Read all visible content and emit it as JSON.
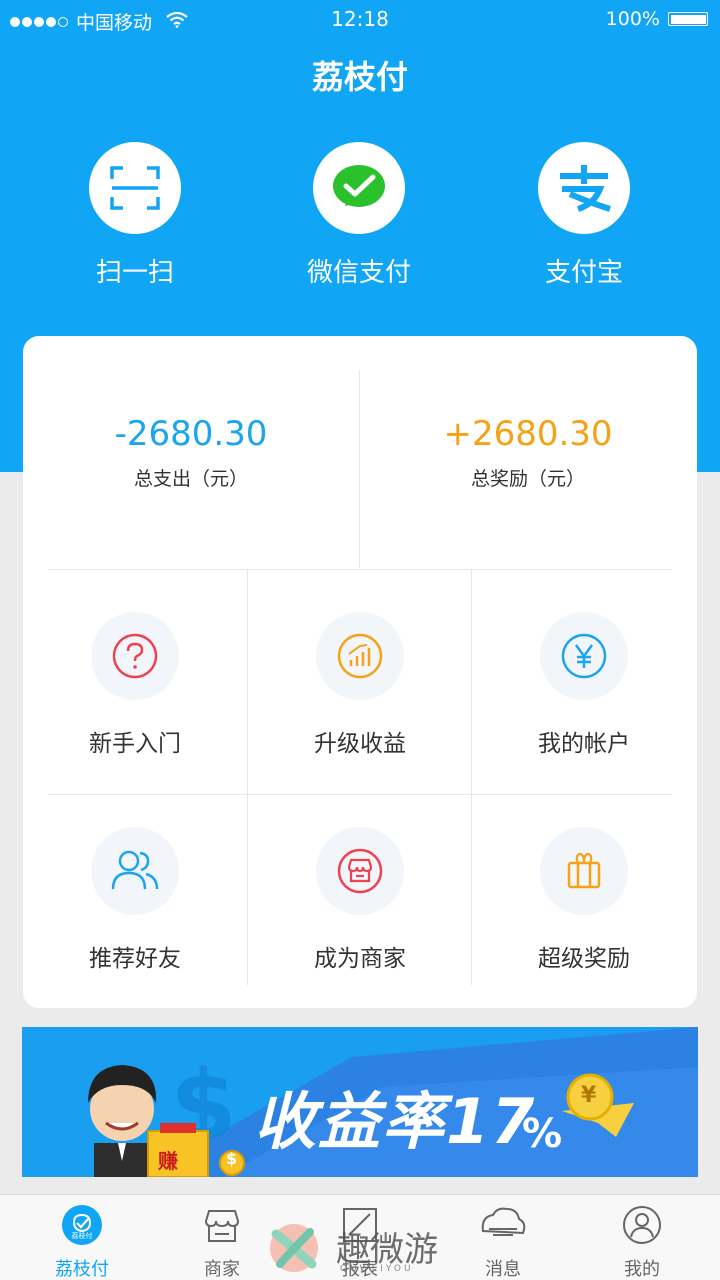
{
  "status_bar": {
    "carrier": "中国移动",
    "time": "12:18",
    "battery": "100%"
  },
  "header": {
    "title": "荔枝付"
  },
  "quick_actions": [
    {
      "label": "扫一扫",
      "icon": "scan-icon"
    },
    {
      "label": "微信支付",
      "icon": "wechat-pay-icon"
    },
    {
      "label": "支付宝",
      "icon": "alipay-icon"
    }
  ],
  "stats": {
    "expense": {
      "value": "-2680.30",
      "label": "总支出（元）",
      "color": "#1aa5ee"
    },
    "reward": {
      "value": "+2680.30",
      "label": "总奖励（元）",
      "color": "#f5a216"
    }
  },
  "menu": [
    {
      "label": "新手入门",
      "icon": "question-icon",
      "color": "#f0424e"
    },
    {
      "label": "升级收益",
      "icon": "chart-icon",
      "color": "#f5a216"
    },
    {
      "label": "我的帐户",
      "icon": "yen-icon",
      "color": "#1aa5ee"
    },
    {
      "label": "推荐好友",
      "icon": "users-icon",
      "color": "#1aa5ee"
    },
    {
      "label": "成为商家",
      "icon": "store-icon",
      "color": "#f0424e"
    },
    {
      "label": "超级奖励",
      "icon": "gift-icon",
      "color": "#f5a216"
    }
  ],
  "banner": {
    "headline": "收益率17",
    "percent": "%",
    "coin_symbol": "¥",
    "badge": "赚",
    "money_symbol": "$"
  },
  "tabbar": [
    {
      "label": "荔枝付",
      "icon": "lychee-pay-icon",
      "active": true,
      "badge": "荔枝付"
    },
    {
      "label": "商家",
      "icon": "store-icon",
      "active": false
    },
    {
      "label": "报表",
      "icon": "report-icon",
      "active": false
    },
    {
      "label": "消息",
      "icon": "message-icon",
      "active": false
    },
    {
      "label": "我的",
      "icon": "user-icon",
      "active": false
    }
  ],
  "watermark": {
    "text": "趣微游",
    "subtext": "QUWEIYOU"
  },
  "colors": {
    "primary": "#10a5f5",
    "orange": "#f5a216",
    "red": "#f0424e"
  }
}
